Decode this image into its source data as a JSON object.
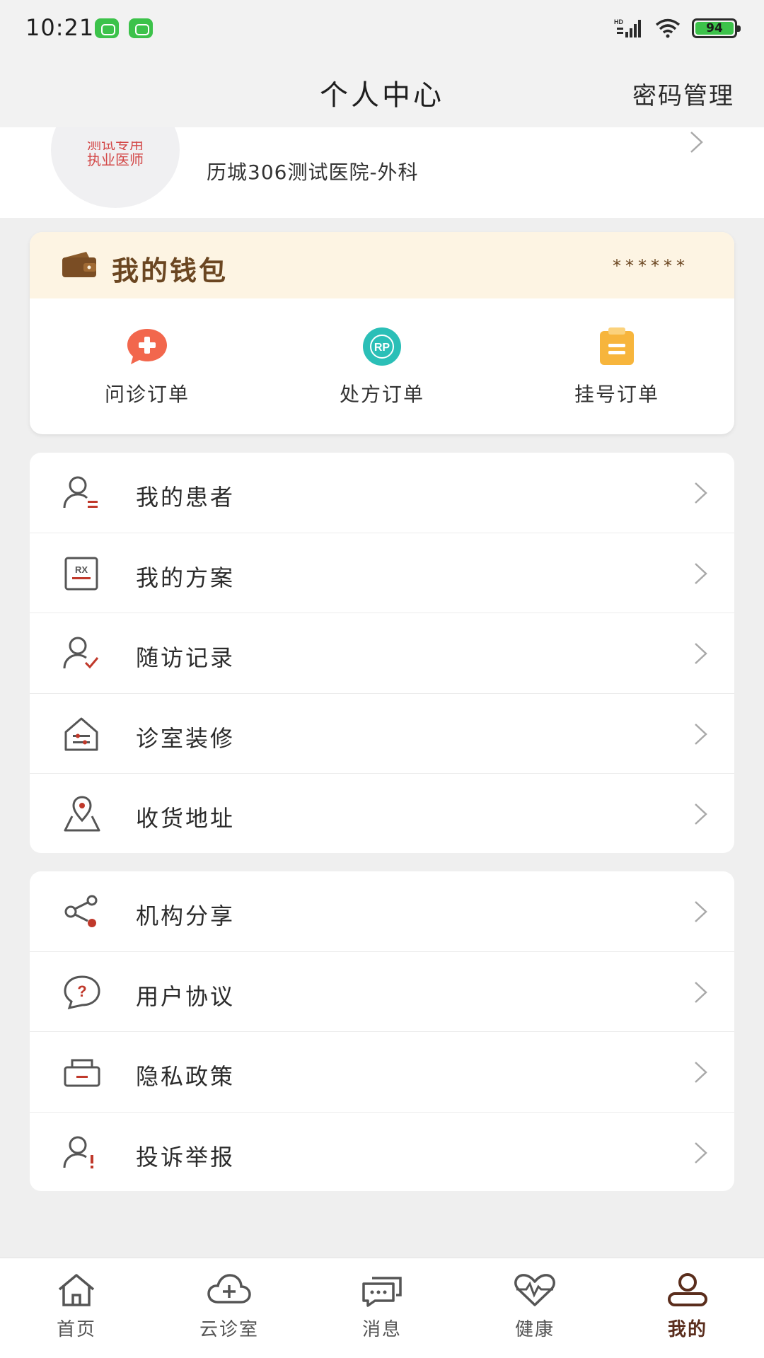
{
  "status_bar": {
    "time": "10:21",
    "network": "HD",
    "battery": "94",
    "icons": [
      "app-notification-icon",
      "app-notification-icon",
      "signal-icon",
      "wifi-icon",
      "battery-icon"
    ]
  },
  "header": {
    "title": "个人中心",
    "action": "密码管理"
  },
  "profile": {
    "badge_top": "测试专用",
    "badge_main": "执业医师",
    "hospital": "历城306测试医院-外科"
  },
  "wallet": {
    "title": "我的钱包",
    "balance_masked": "******",
    "orders": [
      {
        "label": "问诊订单",
        "icon": "consult-chat-icon",
        "color": "#f2674d"
      },
      {
        "label": "处方订单",
        "icon": "rp-prescription-icon",
        "color": "#2bbfb7"
      },
      {
        "label": "挂号订单",
        "icon": "clipboard-icon",
        "color": "#f7b53c"
      }
    ]
  },
  "menu_primary": [
    {
      "label": "我的患者",
      "icon": "patient-icon"
    },
    {
      "label": "我的方案",
      "icon": "rx-plan-icon"
    },
    {
      "label": "随访记录",
      "icon": "follow-up-icon"
    },
    {
      "label": "诊室装修",
      "icon": "clinic-house-icon"
    },
    {
      "label": "收货地址",
      "icon": "location-pin-icon"
    }
  ],
  "menu_secondary": [
    {
      "label": "机构分享",
      "icon": "share-icon"
    },
    {
      "label": "用户协议",
      "icon": "question-bubble-icon"
    },
    {
      "label": "隐私政策",
      "icon": "privacy-box-icon"
    },
    {
      "label": "投诉举报",
      "icon": "complaint-user-icon"
    }
  ],
  "tabbar": [
    {
      "label": "首页",
      "icon": "home-icon",
      "active": false
    },
    {
      "label": "云诊室",
      "icon": "cloud-plus-icon",
      "active": false
    },
    {
      "label": "消息",
      "icon": "message-icon",
      "active": false
    },
    {
      "label": "健康",
      "icon": "heart-pulse-icon",
      "active": false
    },
    {
      "label": "我的",
      "icon": "profile-icon",
      "active": true
    }
  ],
  "colors": {
    "brand_brown": "#5a2d1c",
    "wallet_bg": "#fdf4e3",
    "wallet_text": "#6b4621",
    "accent_red": "#c0392b"
  }
}
